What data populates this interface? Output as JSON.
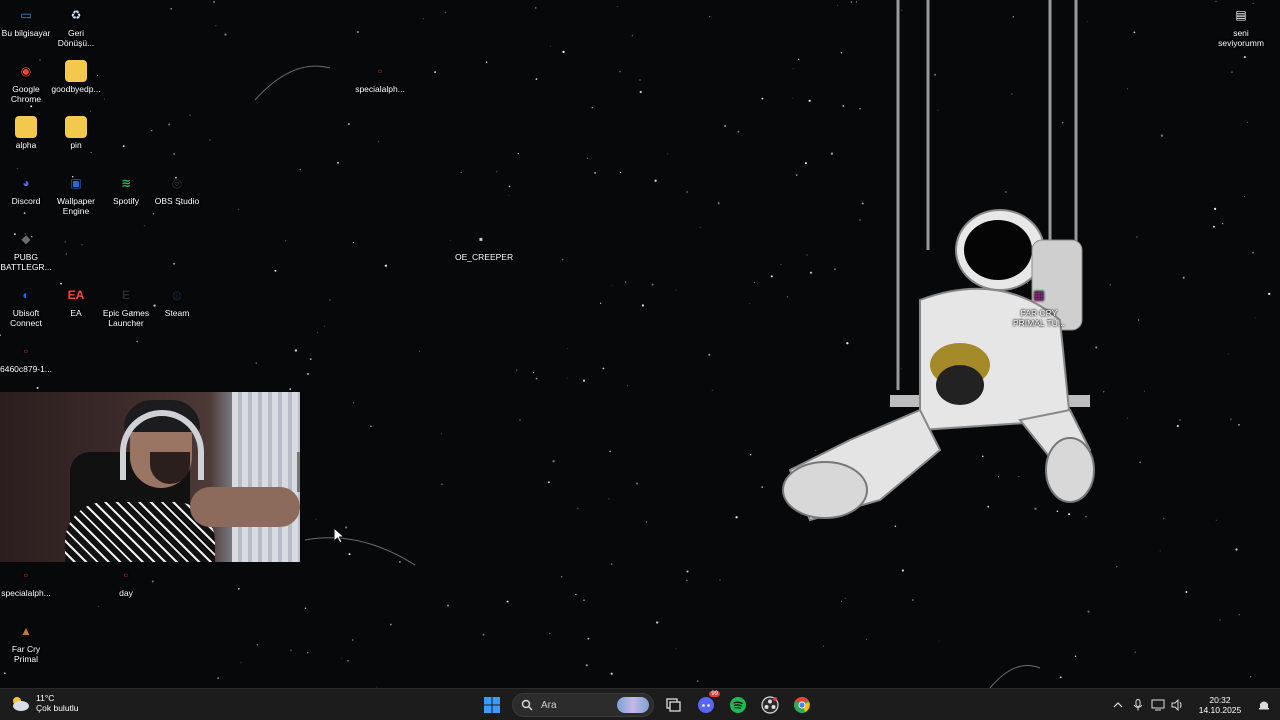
{
  "desktop": {
    "icons": [
      {
        "id": "this-pc",
        "label": "Bu bilgisayar",
        "icon": "monitor-icon",
        "color": "#3aa0e8"
      },
      {
        "id": "recycle-bin",
        "label": "Geri Dönüşü...",
        "icon": "recycle-bin-icon",
        "color": "#cfe3f2"
      },
      {
        "id": "chrome",
        "label": "Google Chrome",
        "icon": "chrome-icon",
        "color": "#e94235"
      },
      {
        "id": "goodbyedp",
        "label": "goodbyedp...",
        "icon": "folder-icon",
        "color": "#f2c94c"
      },
      {
        "id": "alpha",
        "label": "alpha",
        "icon": "folder-icon",
        "color": "#f2c94c"
      },
      {
        "id": "pin",
        "label": "pin",
        "icon": "folder-icon",
        "color": "#f2c94c"
      },
      {
        "id": "discord",
        "label": "Discord",
        "icon": "discord-icon",
        "color": "#5865f2"
      },
      {
        "id": "wallpaper-engine",
        "label": "Wallpaper Engine",
        "icon": "wallpaper-engine-icon",
        "color": "#1f6fd1"
      },
      {
        "id": "spotify",
        "label": "Spotify",
        "icon": "spotify-icon",
        "color": "#1db954"
      },
      {
        "id": "obs",
        "label": "OBS Studio",
        "icon": "obs-icon",
        "color": "#302e31"
      },
      {
        "id": "pubg",
        "label": "PUBG BATTLEGR...",
        "icon": "pubg-icon",
        "color": "#6b6b6b"
      },
      {
        "id": "ubisoft",
        "label": "Ubisoft Connect",
        "icon": "ubisoft-icon",
        "color": "#0070ff"
      },
      {
        "id": "ea",
        "label": "EA",
        "icon": "ea-icon",
        "color": "#ff4747"
      },
      {
        "id": "epic",
        "label": "Epic Games Launcher",
        "icon": "epic-games-icon",
        "color": "#2a2a2a"
      },
      {
        "id": "steam",
        "label": "Steam",
        "icon": "steam-icon",
        "color": "#1b2838"
      },
      {
        "id": "file-6460",
        "label": "6460c879-1...",
        "icon": "file-icon",
        "color": "#b03030"
      },
      {
        "id": "specialalph-1",
        "label": "specialalph...",
        "icon": "file-icon",
        "color": "#b03030"
      },
      {
        "id": "oe-creeper",
        "label": "OE_CREEPER",
        "icon": "shortcut-icon",
        "color": "#cccccc"
      },
      {
        "id": "seni",
        "label": "seni seviyorumm",
        "icon": "text-file-icon",
        "color": "#ffffff"
      },
      {
        "id": "farcry-tu",
        "label": "FAR CRY PRIMAL TÜ...",
        "icon": "archive-icon",
        "color": "#8b2b8b"
      },
      {
        "id": "specialalph-2",
        "label": "specialalph...",
        "icon": "file-icon",
        "color": "#b03030"
      },
      {
        "id": "day",
        "label": "day",
        "icon": "file-icon",
        "color": "#b03030"
      },
      {
        "id": "farcry-primal",
        "label": "Far Cry Primal",
        "icon": "far-cry-icon",
        "color": "#c07b2b"
      }
    ]
  },
  "taskbar": {
    "weather": {
      "temp": "11°C",
      "condition": "Çok bulutlu",
      "icon": "cloud-sun-icon"
    },
    "search_placeholder": "Ara",
    "apps": [
      {
        "id": "start",
        "icon": "windows-start-icon"
      },
      {
        "id": "task-view",
        "icon": "task-view-icon"
      },
      {
        "id": "discord",
        "icon": "discord-icon",
        "badge": "99"
      },
      {
        "id": "spotify",
        "icon": "spotify-icon"
      },
      {
        "id": "obs",
        "icon": "obs-icon"
      },
      {
        "id": "chrome",
        "icon": "chrome-icon"
      }
    ],
    "tray": {
      "time": "20:32",
      "date": "14.10.2025"
    }
  }
}
